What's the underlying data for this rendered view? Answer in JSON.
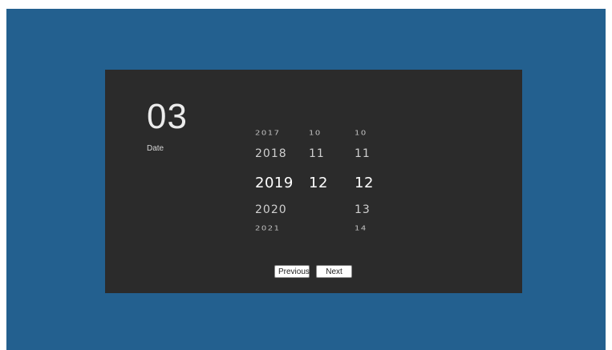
{
  "stepper": {
    "number": "03",
    "label": "Date"
  },
  "picker": {
    "years": [
      "2017",
      "2018",
      "2019",
      "2020",
      "2021"
    ],
    "months": [
      "10",
      "11",
      "12"
    ],
    "days": [
      "10",
      "11",
      "12",
      "13",
      "14"
    ],
    "selected": {
      "year": "2019",
      "month": "12",
      "day": "12"
    }
  },
  "buttons": {
    "previous_label": "Previous",
    "next_label": "Next"
  },
  "colors": {
    "background": "#23608f",
    "card": "#2b2b2b",
    "text_selected": "#ffffff",
    "text_dim": "#cfcfcf"
  }
}
